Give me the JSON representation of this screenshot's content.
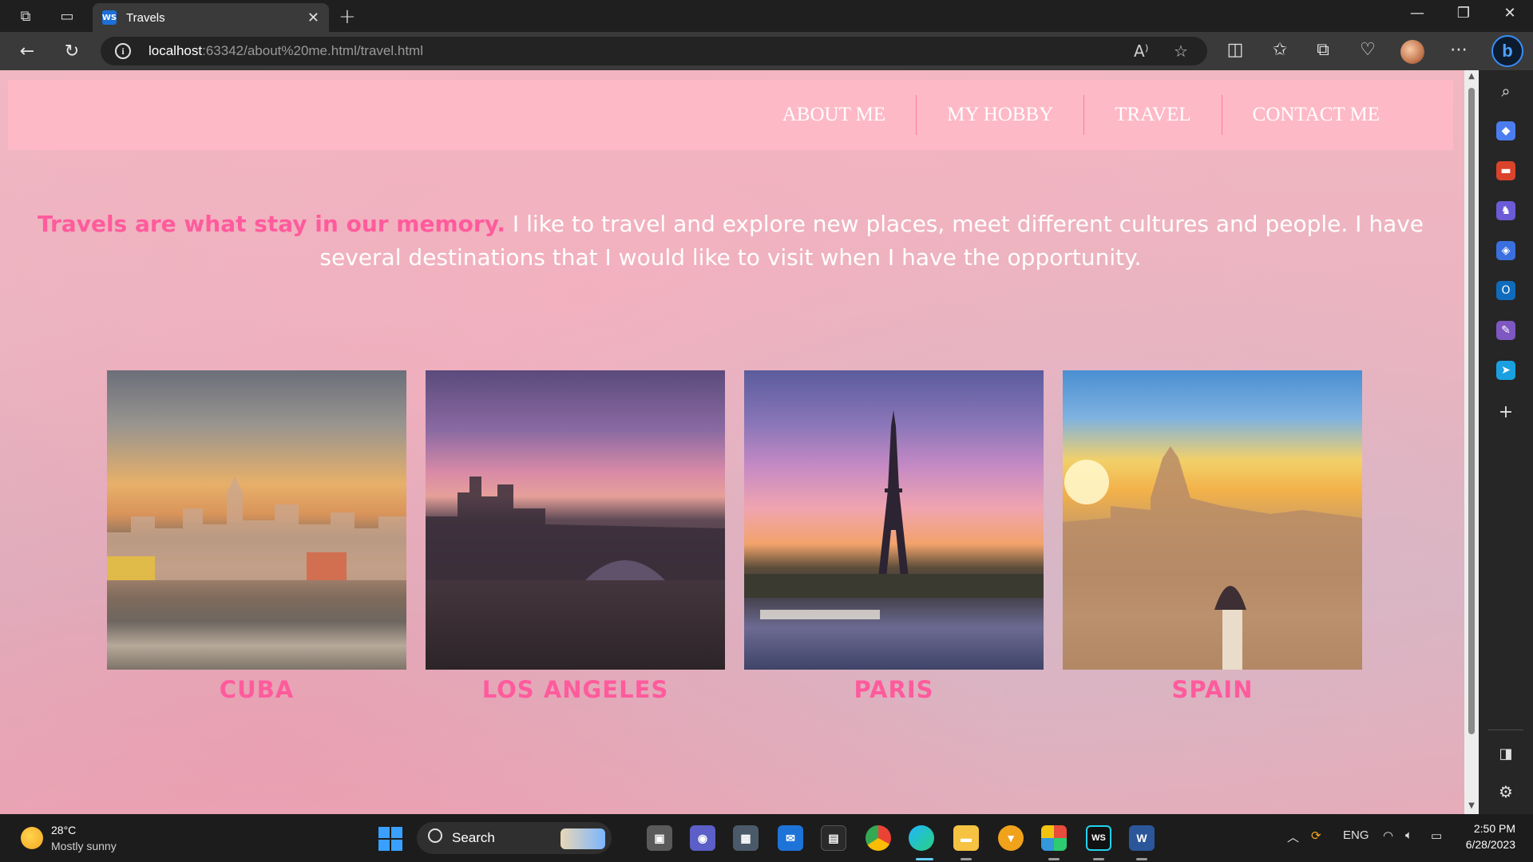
{
  "browser": {
    "tab_title": "Travels",
    "favicon_text": "WS",
    "url_host": "localhost",
    "url_rest": ":63342/about%20me.html/travel.html",
    "bing_label": "b"
  },
  "site": {
    "nav": [
      "ABOUT ME",
      "MY HOBBY",
      "TRAVEL",
      "CONTACT ME"
    ],
    "intro_highlight": "Travels are what stay in our memory.",
    "intro_text": " I like to travel and explore new places, meet different cultures and people. I have several destinations that I would like to visit when I have the opportunity.",
    "destinations": [
      "CUBA",
      "LOS ANGELES",
      "PARIS",
      "SPAIN"
    ],
    "accent_color": "#ff5b9c",
    "nav_bg": "#fdb9c6"
  },
  "taskbar": {
    "temperature": "28°C",
    "weather": "Mostly sunny",
    "search_label": "Search",
    "language": "ENG",
    "time": "2:50 PM",
    "date": "6/28/2023"
  }
}
